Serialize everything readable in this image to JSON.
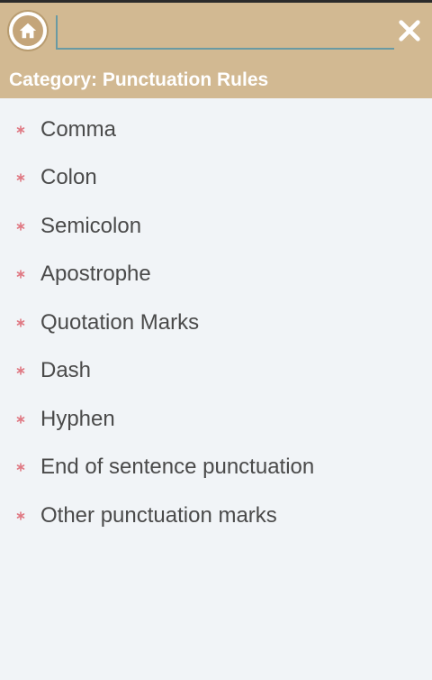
{
  "header": {
    "home_icon": "home-icon",
    "search": {
      "value": "",
      "placeholder": ""
    },
    "close_icon": "close-icon",
    "category_title": "Category: Punctuation Rules"
  },
  "list": {
    "bullet_icon": "asterisk-bullet-icon",
    "bullet_color": "#e07a84",
    "items": [
      {
        "label": "Comma"
      },
      {
        "label": "Colon"
      },
      {
        "label": "Semicolon"
      },
      {
        "label": "Apostrophe"
      },
      {
        "label": "Quotation Marks"
      },
      {
        "label": "Dash"
      },
      {
        "label": "Hyphen"
      },
      {
        "label": "End of sentence punctuation"
      },
      {
        "label": "Other punctuation marks"
      }
    ]
  },
  "colors": {
    "header_bg": "#d2b992",
    "page_bg": "#f1f4f7",
    "text": "#4a4a4a",
    "search_underline": "#6a9aa3"
  }
}
